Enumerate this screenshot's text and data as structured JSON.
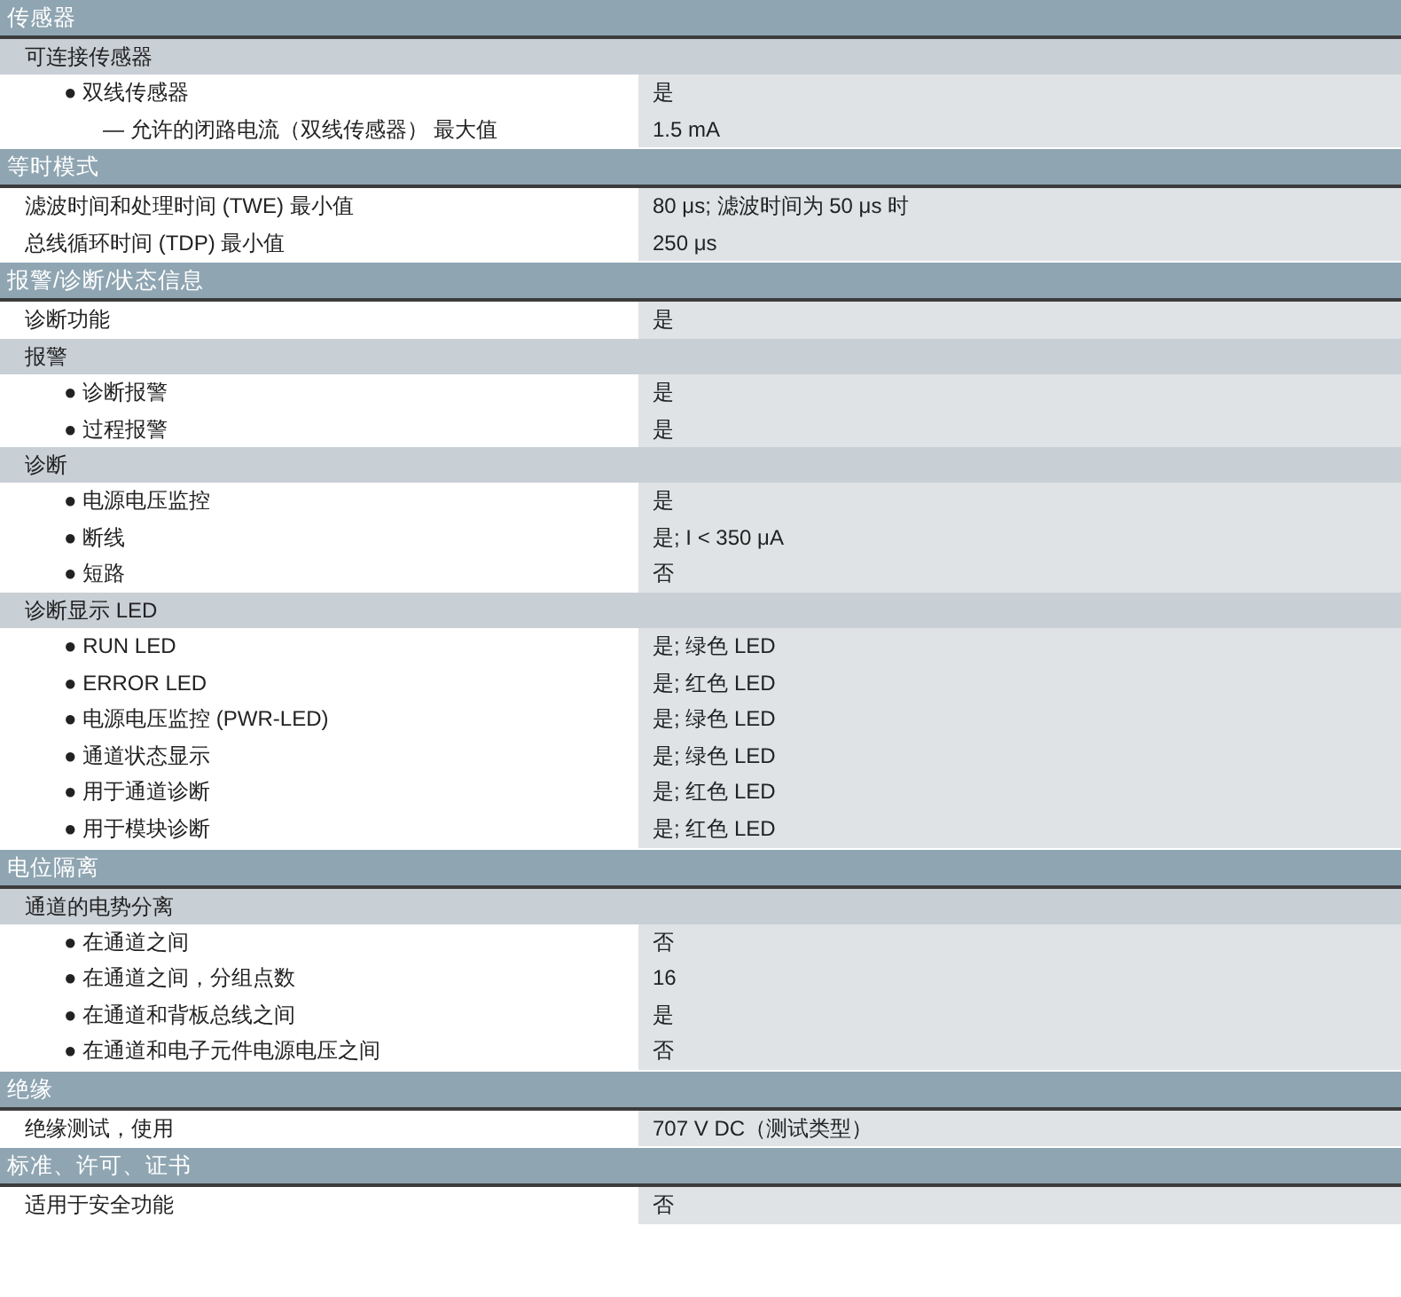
{
  "sections": [
    {
      "title": "传感器",
      "items": [
        {
          "kind": "subheading",
          "label": "可连接传感器",
          "children": [
            {
              "kind": "row",
              "label": "● 双线传感器",
              "value": "是",
              "children": [
                {
                  "kind": "row",
                  "label": "— 允许的闭路电流（双线传感器） 最大值",
                  "value": "1.5 mA"
                }
              ]
            }
          ]
        }
      ]
    },
    {
      "title": "等时模式",
      "items": [
        {
          "kind": "row",
          "label": "滤波时间和处理时间 (TWE) 最小值",
          "value": "80 μs; 滤波时间为 50 μs 时"
        },
        {
          "kind": "row",
          "label": "总线循环时间 (TDP) 最小值",
          "value": "250 μs"
        }
      ]
    },
    {
      "title": "报警/诊断/状态信息",
      "items": [
        {
          "kind": "row",
          "label": "诊断功能",
          "value": "是"
        },
        {
          "kind": "subheading",
          "label": "报警",
          "children": [
            {
              "kind": "row",
              "label": "● 诊断报警",
              "value": "是"
            },
            {
              "kind": "row",
              "label": "● 过程报警",
              "value": "是"
            }
          ]
        },
        {
          "kind": "subheading",
          "label": "诊断",
          "children": [
            {
              "kind": "row",
              "label": "● 电源电压监控",
              "value": "是"
            },
            {
              "kind": "row",
              "label": "● 断线",
              "value": "是; I < 350 μA"
            },
            {
              "kind": "row",
              "label": "● 短路",
              "value": "否"
            }
          ]
        },
        {
          "kind": "subheading",
          "label": "诊断显示 LED",
          "children": [
            {
              "kind": "row",
              "label": "● RUN LED",
              "value": "是; 绿色 LED"
            },
            {
              "kind": "row",
              "label": "● ERROR LED",
              "value": "是; 红色 LED"
            },
            {
              "kind": "row",
              "label": "● 电源电压监控 (PWR-LED)",
              "value": "是; 绿色 LED"
            },
            {
              "kind": "row",
              "label": "● 通道状态显示",
              "value": "是; 绿色 LED"
            },
            {
              "kind": "row",
              "label": "● 用于通道诊断",
              "value": "是; 红色 LED"
            },
            {
              "kind": "row",
              "label": "● 用于模块诊断",
              "value": "是; 红色 LED"
            }
          ]
        }
      ]
    },
    {
      "title": "电位隔离",
      "items": [
        {
          "kind": "subheading",
          "label": "通道的电势分离",
          "children": [
            {
              "kind": "row",
              "label": "● 在通道之间",
              "value": "否"
            },
            {
              "kind": "row",
              "label": "● 在通道之间，分组点数",
              "value": "16"
            },
            {
              "kind": "row",
              "label": "● 在通道和背板总线之间",
              "value": "是"
            },
            {
              "kind": "row",
              "label": "● 在通道和电子元件电源电压之间",
              "value": "否"
            }
          ]
        }
      ]
    },
    {
      "title": "绝缘",
      "items": [
        {
          "kind": "row",
          "label": "绝缘测试，使用",
          "value": "707 V DC（测试类型）"
        }
      ]
    },
    {
      "title": "标准、许可、证书",
      "items": [
        {
          "kind": "row",
          "label": "适用于安全功能",
          "value": "否"
        }
      ]
    }
  ]
}
